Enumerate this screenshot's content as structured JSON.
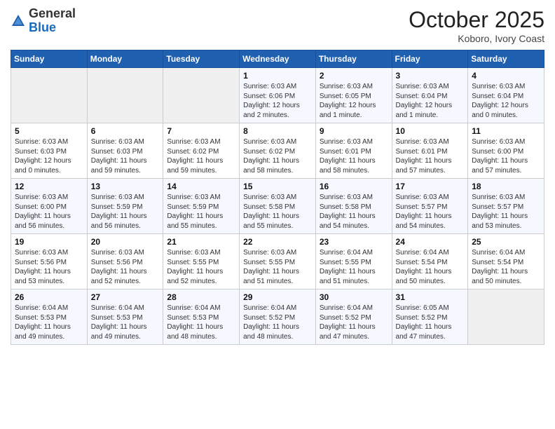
{
  "header": {
    "logo_general": "General",
    "logo_blue": "Blue",
    "month_title": "October 2025",
    "location": "Koboro, Ivory Coast"
  },
  "weekdays": [
    "Sunday",
    "Monday",
    "Tuesday",
    "Wednesday",
    "Thursday",
    "Friday",
    "Saturday"
  ],
  "weeks": [
    [
      {
        "day": "",
        "info": ""
      },
      {
        "day": "",
        "info": ""
      },
      {
        "day": "",
        "info": ""
      },
      {
        "day": "1",
        "info": "Sunrise: 6:03 AM\nSunset: 6:06 PM\nDaylight: 12 hours\nand 2 minutes."
      },
      {
        "day": "2",
        "info": "Sunrise: 6:03 AM\nSunset: 6:05 PM\nDaylight: 12 hours\nand 1 minute."
      },
      {
        "day": "3",
        "info": "Sunrise: 6:03 AM\nSunset: 6:04 PM\nDaylight: 12 hours\nand 1 minute."
      },
      {
        "day": "4",
        "info": "Sunrise: 6:03 AM\nSunset: 6:04 PM\nDaylight: 12 hours\nand 0 minutes."
      }
    ],
    [
      {
        "day": "5",
        "info": "Sunrise: 6:03 AM\nSunset: 6:03 PM\nDaylight: 12 hours\nand 0 minutes."
      },
      {
        "day": "6",
        "info": "Sunrise: 6:03 AM\nSunset: 6:03 PM\nDaylight: 11 hours\nand 59 minutes."
      },
      {
        "day": "7",
        "info": "Sunrise: 6:03 AM\nSunset: 6:02 PM\nDaylight: 11 hours\nand 59 minutes."
      },
      {
        "day": "8",
        "info": "Sunrise: 6:03 AM\nSunset: 6:02 PM\nDaylight: 11 hours\nand 58 minutes."
      },
      {
        "day": "9",
        "info": "Sunrise: 6:03 AM\nSunset: 6:01 PM\nDaylight: 11 hours\nand 58 minutes."
      },
      {
        "day": "10",
        "info": "Sunrise: 6:03 AM\nSunset: 6:01 PM\nDaylight: 11 hours\nand 57 minutes."
      },
      {
        "day": "11",
        "info": "Sunrise: 6:03 AM\nSunset: 6:00 PM\nDaylight: 11 hours\nand 57 minutes."
      }
    ],
    [
      {
        "day": "12",
        "info": "Sunrise: 6:03 AM\nSunset: 6:00 PM\nDaylight: 11 hours\nand 56 minutes."
      },
      {
        "day": "13",
        "info": "Sunrise: 6:03 AM\nSunset: 5:59 PM\nDaylight: 11 hours\nand 56 minutes."
      },
      {
        "day": "14",
        "info": "Sunrise: 6:03 AM\nSunset: 5:59 PM\nDaylight: 11 hours\nand 55 minutes."
      },
      {
        "day": "15",
        "info": "Sunrise: 6:03 AM\nSunset: 5:58 PM\nDaylight: 11 hours\nand 55 minutes."
      },
      {
        "day": "16",
        "info": "Sunrise: 6:03 AM\nSunset: 5:58 PM\nDaylight: 11 hours\nand 54 minutes."
      },
      {
        "day": "17",
        "info": "Sunrise: 6:03 AM\nSunset: 5:57 PM\nDaylight: 11 hours\nand 54 minutes."
      },
      {
        "day": "18",
        "info": "Sunrise: 6:03 AM\nSunset: 5:57 PM\nDaylight: 11 hours\nand 53 minutes."
      }
    ],
    [
      {
        "day": "19",
        "info": "Sunrise: 6:03 AM\nSunset: 5:56 PM\nDaylight: 11 hours\nand 53 minutes."
      },
      {
        "day": "20",
        "info": "Sunrise: 6:03 AM\nSunset: 5:56 PM\nDaylight: 11 hours\nand 52 minutes."
      },
      {
        "day": "21",
        "info": "Sunrise: 6:03 AM\nSunset: 5:55 PM\nDaylight: 11 hours\nand 52 minutes."
      },
      {
        "day": "22",
        "info": "Sunrise: 6:03 AM\nSunset: 5:55 PM\nDaylight: 11 hours\nand 51 minutes."
      },
      {
        "day": "23",
        "info": "Sunrise: 6:04 AM\nSunset: 5:55 PM\nDaylight: 11 hours\nand 51 minutes."
      },
      {
        "day": "24",
        "info": "Sunrise: 6:04 AM\nSunset: 5:54 PM\nDaylight: 11 hours\nand 50 minutes."
      },
      {
        "day": "25",
        "info": "Sunrise: 6:04 AM\nSunset: 5:54 PM\nDaylight: 11 hours\nand 50 minutes."
      }
    ],
    [
      {
        "day": "26",
        "info": "Sunrise: 6:04 AM\nSunset: 5:53 PM\nDaylight: 11 hours\nand 49 minutes."
      },
      {
        "day": "27",
        "info": "Sunrise: 6:04 AM\nSunset: 5:53 PM\nDaylight: 11 hours\nand 49 minutes."
      },
      {
        "day": "28",
        "info": "Sunrise: 6:04 AM\nSunset: 5:53 PM\nDaylight: 11 hours\nand 48 minutes."
      },
      {
        "day": "29",
        "info": "Sunrise: 6:04 AM\nSunset: 5:52 PM\nDaylight: 11 hours\nand 48 minutes."
      },
      {
        "day": "30",
        "info": "Sunrise: 6:04 AM\nSunset: 5:52 PM\nDaylight: 11 hours\nand 47 minutes."
      },
      {
        "day": "31",
        "info": "Sunrise: 6:05 AM\nSunset: 5:52 PM\nDaylight: 11 hours\nand 47 minutes."
      },
      {
        "day": "",
        "info": ""
      }
    ]
  ]
}
